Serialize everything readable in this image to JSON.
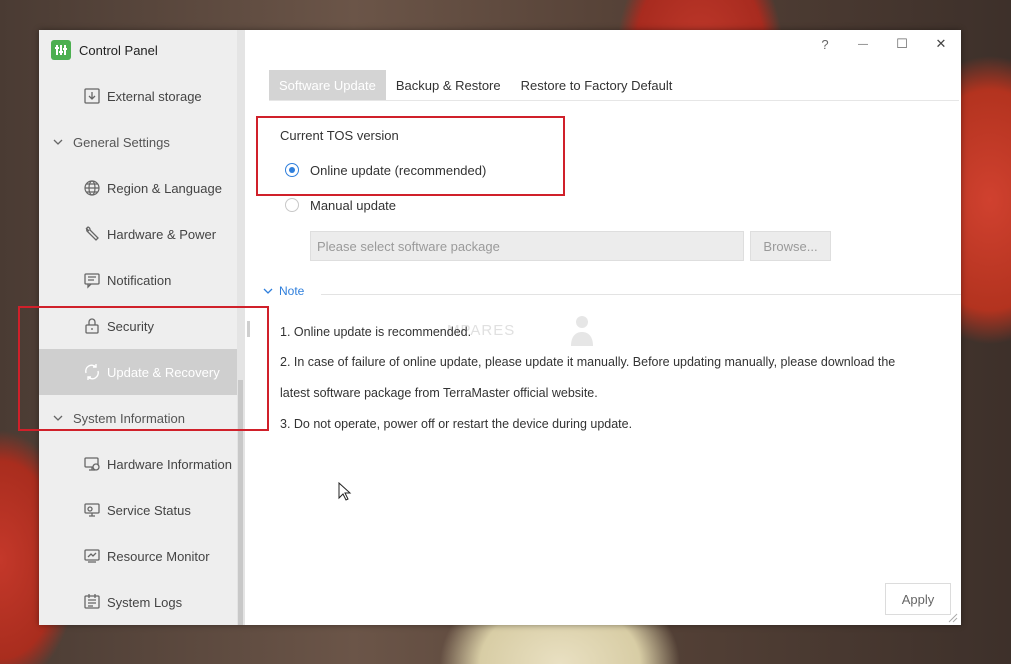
{
  "window": {
    "title": "Control Panel",
    "help": "?",
    "minimize": "—",
    "maximize": "☐",
    "close": "✕"
  },
  "sidebar": {
    "items": [
      {
        "label": "External storage",
        "icon": "external-storage-icon"
      },
      {
        "label": "General Settings",
        "group": true
      },
      {
        "label": "Region & Language",
        "icon": "globe-icon"
      },
      {
        "label": "Hardware & Power",
        "icon": "wrench-icon"
      },
      {
        "label": "Notification",
        "icon": "notification-icon"
      },
      {
        "label": "Security",
        "icon": "lock-icon"
      },
      {
        "label": "Update & Recovery",
        "icon": "update-recovery-icon",
        "active": true
      },
      {
        "label": "System Information",
        "group": true
      },
      {
        "label": "Hardware Information",
        "icon": "hardware-info-icon"
      },
      {
        "label": "Service Status",
        "icon": "service-status-icon"
      },
      {
        "label": "Resource Monitor",
        "icon": "resource-monitor-icon"
      },
      {
        "label": "System Logs",
        "icon": "system-logs-icon"
      }
    ]
  },
  "tabs": [
    {
      "label": "Software Update",
      "active": true
    },
    {
      "label": "Backup & Restore"
    },
    {
      "label": "Restore to Factory Default"
    }
  ],
  "update": {
    "current_version_label": "Current TOS version",
    "online_label": "Online update (recommended)",
    "manual_label": "Manual update",
    "package_placeholder": "Please select software package",
    "browse_label": "Browse..."
  },
  "note": {
    "title": "Note",
    "lines": [
      "1. Online update is recommended.",
      "2. In case of failure of online update, please update it manually. Before updating manually, please download the",
      "latest software package from TerraMaster official website.",
      "3. Do not operate, power off or restart the device during update."
    ]
  },
  "watermark": "MPARES",
  "apply_label": "Apply",
  "colors": {
    "accent": "#2f7fdc",
    "annotation": "#d0202a",
    "logo": "#4caf50"
  }
}
